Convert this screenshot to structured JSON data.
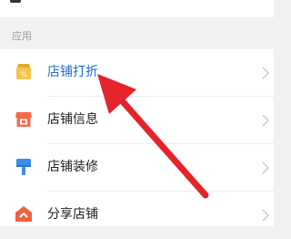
{
  "section": {
    "title": "应用"
  },
  "items": [
    {
      "label": "店铺打折",
      "icon": "discount-tag-icon",
      "highlight": true
    },
    {
      "label": "店铺信息",
      "icon": "store-info-icon",
      "highlight": false
    },
    {
      "label": "店铺装修",
      "icon": "paint-brush-icon",
      "highlight": false
    },
    {
      "label": "分享店铺",
      "icon": "share-store-icon",
      "highlight": false
    }
  ],
  "colors": {
    "highlight_text": "#1f6fd1",
    "annotation_arrow": "#e5232b",
    "discount_icon": "#f5c44a",
    "store_icon": "#f26b4b",
    "brush_icon": "#3b8ee8",
    "share_icon": "#f0603d"
  }
}
